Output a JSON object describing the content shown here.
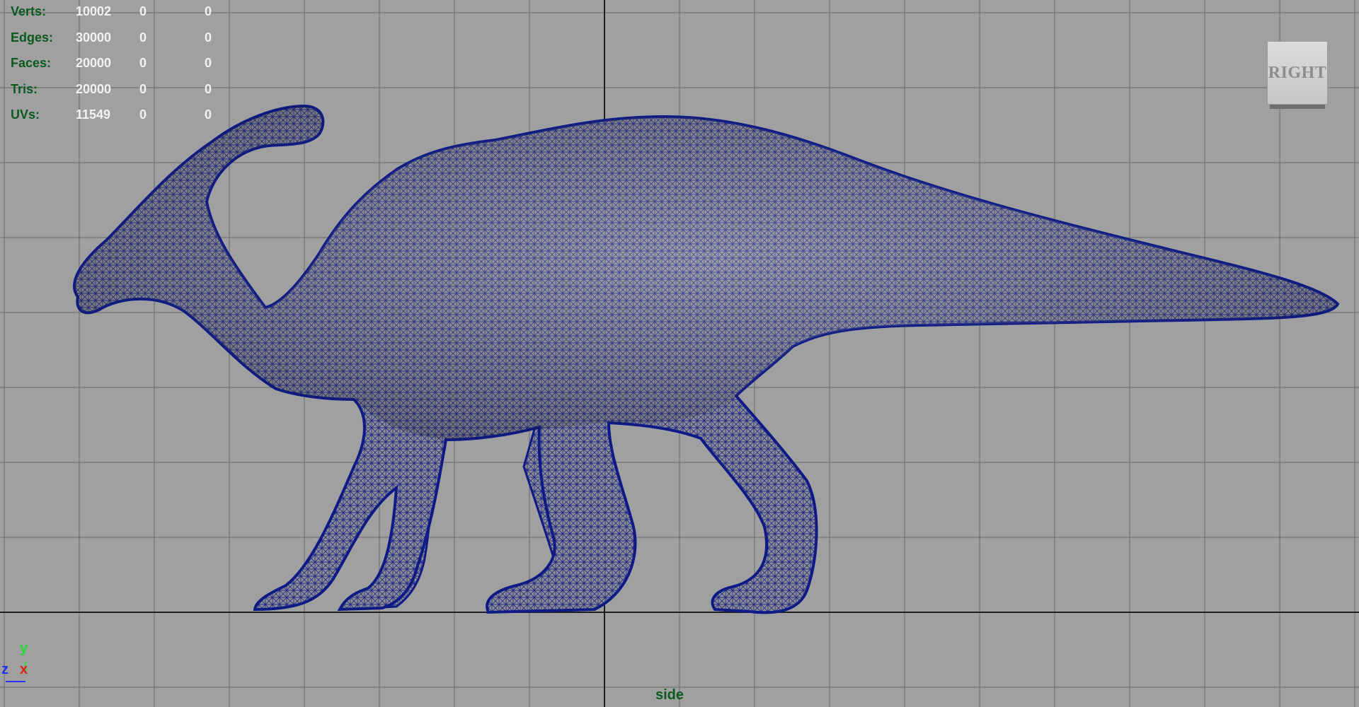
{
  "viewport": {
    "view_name": "side",
    "viewcube_label": "RIGHT",
    "background_color": "#a0a0a0",
    "grid_color": "#7a7a7a",
    "wireframe_color": "#0e1a86",
    "mesh_fill_color": "#8f8f92"
  },
  "hud": {
    "rows": [
      {
        "label": "Verts:",
        "v1": "10002",
        "v2": "0",
        "v3": "0"
      },
      {
        "label": "Edges:",
        "v1": "30000",
        "v2": "0",
        "v3": "0"
      },
      {
        "label": "Faces:",
        "v1": "20000",
        "v2": "0",
        "v3": "0"
      },
      {
        "label": "Tris:",
        "v1": "20000",
        "v2": "0",
        "v3": "0"
      },
      {
        "label": "UVs:",
        "v1": "11549",
        "v2": "0",
        "v3": "0"
      }
    ]
  },
  "axis_gizmo": {
    "y_label": "y",
    "z_label": "z",
    "x_label": "x",
    "y_color": "#22dd33",
    "z_color": "#2233ee",
    "x_color": "#e02020"
  },
  "scene": {
    "object_icon": "dinosaur-mesh-icon"
  }
}
